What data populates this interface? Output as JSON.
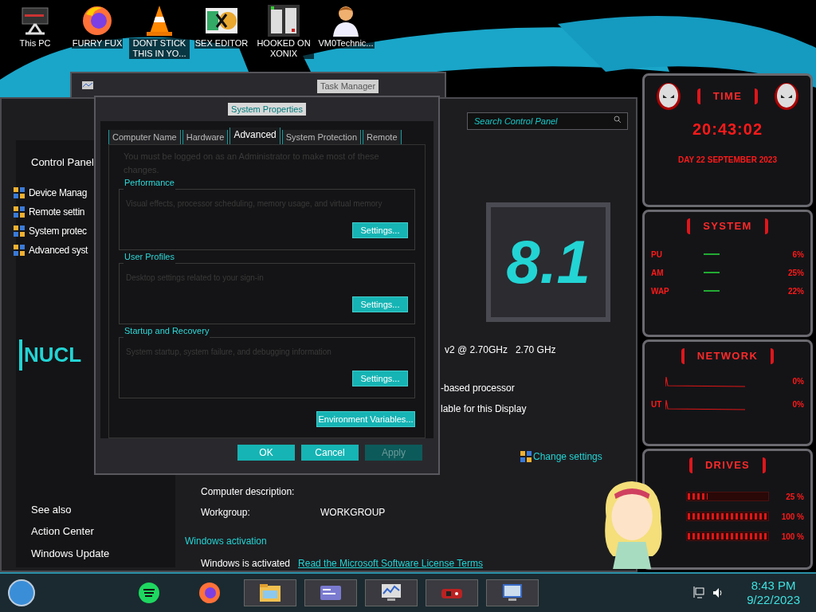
{
  "desktop_icons": [
    {
      "label": "This PC",
      "kind": "computer"
    },
    {
      "label": "FURRY FUX",
      "kind": "browser"
    },
    {
      "label": "DONT STICK THIS IN YO...",
      "kind": "cone"
    },
    {
      "label": "SEX EDITOR",
      "kind": "hex"
    },
    {
      "label": "HOOKED ON XONIX",
      "kind": "game"
    },
    {
      "label": "VM0Technic...",
      "kind": "doctor"
    }
  ],
  "task_manager": {
    "title": "Task Manager"
  },
  "control_panel": {
    "search": {
      "placeholder": "Search Control Panel"
    },
    "sidebar": {
      "home": "Control Panel",
      "links": [
        "Device Manag",
        "Remote settin",
        "System protec",
        "Advanced syst"
      ],
      "logo": "NUCL",
      "see_also": "See also",
      "see_also_links": [
        "Action Center",
        "Windows Update"
      ]
    },
    "logo_version": "8.1",
    "processor": "v2 @ 2.70GHz   2.70 GHz",
    "system_type": "-based processor",
    "pen_touch": "lable for this Display",
    "change_settings": "Change settings",
    "details": [
      {
        "label": "Computer description:"
      },
      {
        "label": "Workgroup:",
        "value": "WORKGROUP"
      }
    ],
    "activation": {
      "heading": "Windows activation",
      "status": "Windows is activated",
      "link": "Read the Microsoft Software License Terms"
    }
  },
  "dialog": {
    "title": "System Properties",
    "tabs": [
      {
        "label": "Computer Name",
        "selected": false
      },
      {
        "label": "Hardware",
        "selected": false
      },
      {
        "label": "Advanced",
        "selected": true
      },
      {
        "label": "System Protection",
        "selected": false
      },
      {
        "label": "Remote",
        "selected": false
      }
    ],
    "notice": "You must be logged on as an Administrator to make most of these changes.",
    "groups": [
      {
        "title": "Performance",
        "description": "Visual effects, processor scheduling, memory usage, and virtual memory",
        "button": "Settings..."
      },
      {
        "title": "User Profiles",
        "description": "Desktop settings related to your sign-in",
        "button": "Settings..."
      },
      {
        "title": "Startup and Recovery",
        "description": "System startup, system failure, and debugging information",
        "button": "Settings..."
      }
    ],
    "env_button": "Environment Variables...",
    "buttons": [
      {
        "label": "OK",
        "disabled": false
      },
      {
        "label": "Cancel",
        "disabled": false
      },
      {
        "label": "Apply",
        "disabled": true
      }
    ]
  },
  "widgets": {
    "time": {
      "title": "TIME",
      "clock": "20:43:02",
      "date": "DAY 22 SEPTEMBER 2023"
    },
    "system": {
      "title": "SYSTEM",
      "rows": [
        {
          "label": "PU",
          "value": "6%"
        },
        {
          "label": "AM",
          "value": "25%"
        },
        {
          "label": "WAP",
          "value": "22%"
        }
      ]
    },
    "network": {
      "title": "NETWORK",
      "rows": [
        {
          "value": "0%"
        },
        {
          "label": "UT",
          "value": "0%"
        }
      ]
    },
    "drives": {
      "title": "DRIVES",
      "rows": [
        {
          "value": "25 %",
          "level": 0.25
        },
        {
          "value": "100 %",
          "level": 1
        },
        {
          "value": "100 %",
          "level": 1
        }
      ]
    }
  },
  "taskbar": {
    "apps": [
      {
        "kind": "music",
        "selected": false
      },
      {
        "kind": "browser",
        "selected": false
      },
      {
        "kind": "folder",
        "selected": true
      },
      {
        "kind": "card",
        "selected": true
      },
      {
        "kind": "monitor",
        "selected": true
      },
      {
        "kind": "game",
        "selected": true
      },
      {
        "kind": "display",
        "selected": true
      }
    ],
    "time": "8:43 PM",
    "date": "9/22/2023"
  }
}
